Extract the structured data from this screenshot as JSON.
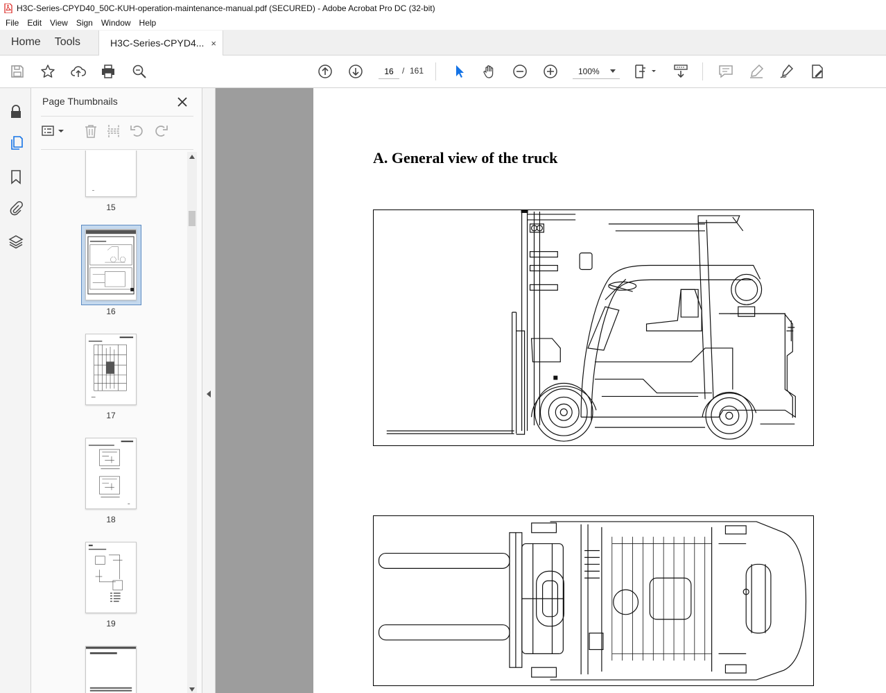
{
  "window": {
    "title": "H3C-Series-CPYD40_50C-KUH-operation-maintenance-manual.pdf (SECURED) - Adobe Acrobat Pro DC (32-bit)"
  },
  "menu": [
    "File",
    "Edit",
    "View",
    "Sign",
    "Window",
    "Help"
  ],
  "tabs": {
    "home": "Home",
    "tools": "Tools",
    "document": "H3C-Series-CPYD4...",
    "close": "×"
  },
  "toolbar": {
    "current_page": "16",
    "separator": "/",
    "total_pages": "161",
    "zoom": "100%"
  },
  "thumbnails": {
    "title": "Page Thumbnails",
    "close": "✕",
    "pages": [
      {
        "label": "15",
        "selected": false
      },
      {
        "label": "16",
        "selected": true
      },
      {
        "label": "17",
        "selected": false
      },
      {
        "label": "18",
        "selected": false
      },
      {
        "label": "19",
        "selected": false
      }
    ]
  },
  "document": {
    "heading": "A. General view of the truck"
  },
  "colors": {
    "accent_blue": "#1473e6",
    "selection": "#c5d9ee",
    "doc_background": "#9d9d9d",
    "pdf_icon_red": "#d9201b"
  }
}
